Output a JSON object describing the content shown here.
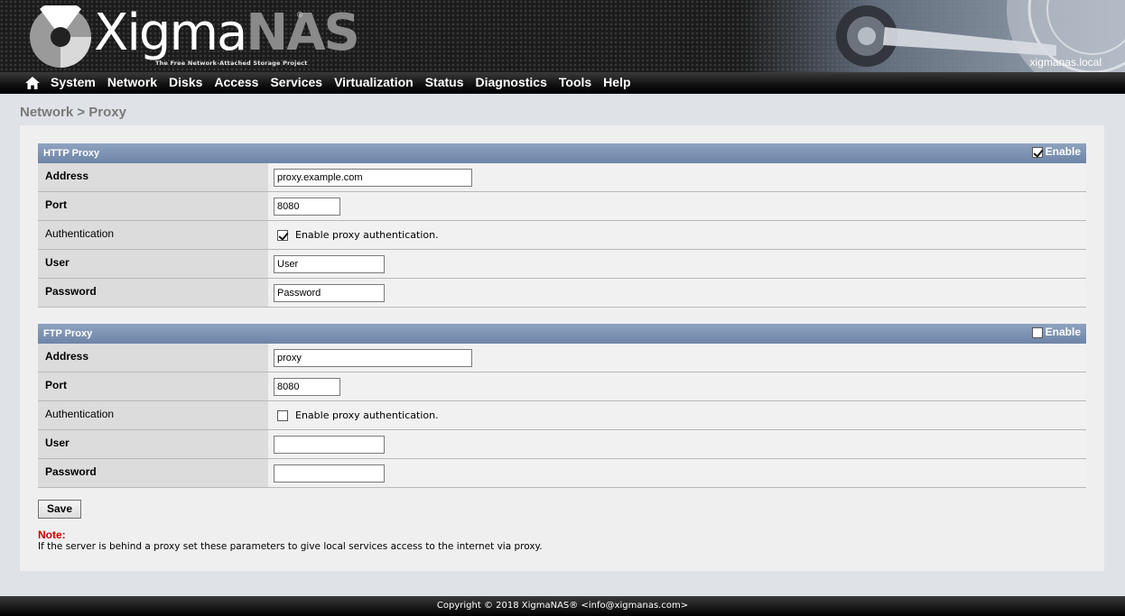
{
  "header": {
    "logo_text_a": "Xigma",
    "logo_text_b": "NAS",
    "logo_reg": "®",
    "tagline": "The Free Network-Attached Storage Project",
    "hostname": "xigmanas.local"
  },
  "nav": {
    "home_icon": "home-icon",
    "items": [
      "System",
      "Network",
      "Disks",
      "Access",
      "Services",
      "Virtualization",
      "Status",
      "Diagnostics",
      "Tools",
      "Help"
    ]
  },
  "page_title": "Network > Proxy",
  "http": {
    "title": "HTTP Proxy",
    "enable_label": "Enable",
    "enabled": true,
    "address_label": "Address",
    "address_value": "proxy.example.com",
    "port_label": "Port",
    "port_value": "8080",
    "auth_label": "Authentication",
    "auth_checkbox_label": "Enable proxy authentication.",
    "auth_enabled": true,
    "user_label": "User",
    "user_value": "User",
    "password_label": "Password",
    "password_value": "Password"
  },
  "ftp": {
    "title": "FTP Proxy",
    "enable_label": "Enable",
    "enabled": false,
    "address_label": "Address",
    "address_value": "proxy",
    "port_label": "Port",
    "port_value": "8080",
    "auth_label": "Authentication",
    "auth_checkbox_label": "Enable proxy authentication.",
    "auth_enabled": false,
    "user_label": "User",
    "user_value": "",
    "password_label": "Password",
    "password_value": ""
  },
  "save_label": "Save",
  "note": {
    "label": "Note:",
    "text": "If the server is behind a proxy set these parameters to give local services access to the internet via proxy."
  },
  "footer": "Copyright © 2018 XigmaNAS® <info@xigmanas.com>",
  "colors": {
    "section_header": "#7a8fb0",
    "note_label": "#cc0000",
    "page_bg": "#dfe2e7"
  }
}
